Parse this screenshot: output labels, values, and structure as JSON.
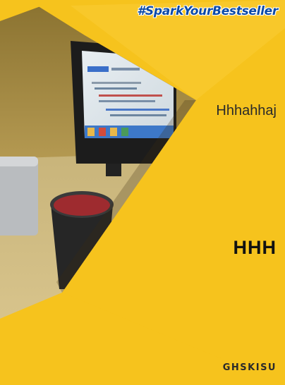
{
  "cover": {
    "hashtag": "#SparkYourBestseller",
    "subtitle": "Hhhahhaj",
    "title": "HHH",
    "author": "GHSKISU"
  },
  "colors": {
    "background": "#f6c31d",
    "accent_light": "#fbd64a",
    "hashtag": "#0b4aa8",
    "title": "#111111"
  }
}
